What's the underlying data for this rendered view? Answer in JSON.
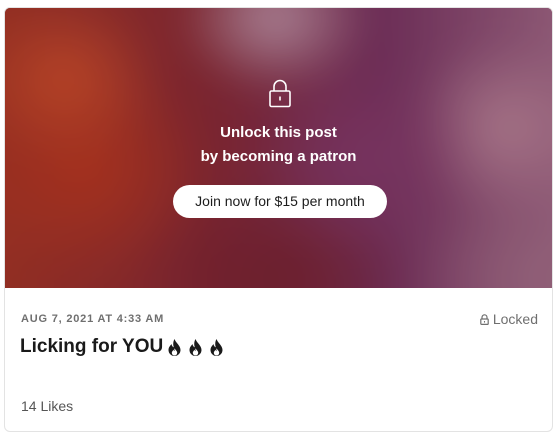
{
  "post": {
    "unlock_line1": "Unlock this post",
    "unlock_line2": "by becoming a patron",
    "join_button": "Join now for $15 per month",
    "date": "AUG 7, 2021 AT 4:33 AM",
    "locked_label": "Locked",
    "title": "Licking for YOU",
    "title_emoji": [
      "fire-icon",
      "fire-icon",
      "fire-icon"
    ],
    "likes": "14 Likes"
  },
  "colors": {
    "text_primary": "#1a1a1a",
    "text_muted": "#6f6f6f",
    "button_bg": "#ffffff"
  }
}
